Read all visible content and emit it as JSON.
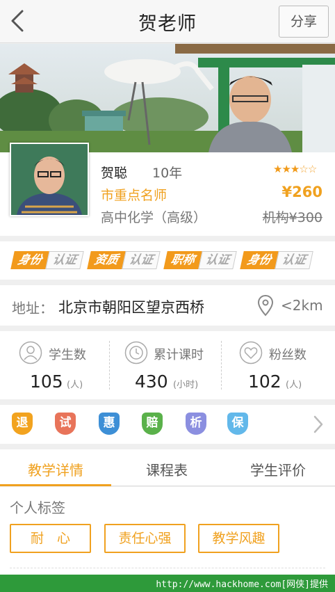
{
  "nav": {
    "title": "贺老师",
    "share_label": "分享"
  },
  "teacher": {
    "name": "贺聪",
    "years": "10年",
    "rating": 3,
    "rating_max": 5,
    "level": "市重点名师",
    "price": "¥260",
    "subject": "高中化学（高级）",
    "original_price": "机构¥300"
  },
  "badges": [
    {
      "type": "身份",
      "status": "认证"
    },
    {
      "type": "资质",
      "status": "认证"
    },
    {
      "type": "职称",
      "status": "认证"
    },
    {
      "type": "身份",
      "status": "认证"
    }
  ],
  "address": {
    "label": "地址：",
    "text": "北京市朝阳区望京西桥",
    "distance": "<2km"
  },
  "stats": [
    {
      "label": "学生数",
      "value": "105",
      "unit": "(人)",
      "icon": "person-icon"
    },
    {
      "label": "累计课时",
      "value": "430",
      "unit": "(小时)",
      "icon": "clock-icon"
    },
    {
      "label": "粉丝数",
      "value": "102",
      "unit": "(人)",
      "icon": "heart-icon"
    }
  ],
  "services": [
    {
      "label": "退",
      "color": "#f2a31f"
    },
    {
      "label": "试",
      "color": "#e8745a"
    },
    {
      "label": "惠",
      "color": "#3d8fd6"
    },
    {
      "label": "赔",
      "color": "#5ab14a"
    },
    {
      "label": "析",
      "color": "#8b8fe0"
    },
    {
      "label": "保",
      "color": "#62b8ea"
    }
  ],
  "tabs": [
    {
      "label": "教学详情",
      "active": true
    },
    {
      "label": "课程表",
      "active": false
    },
    {
      "label": "学生评价",
      "active": false
    }
  ],
  "tags": {
    "title": "个人标签",
    "items": [
      "耐　心",
      "责任心强",
      "教学风趣"
    ]
  },
  "watermark": "http://www.hackhome.com[网侠]提供",
  "colors": {
    "accent": "#f0a11f",
    "watermark_bg": "#2e9a3a"
  }
}
